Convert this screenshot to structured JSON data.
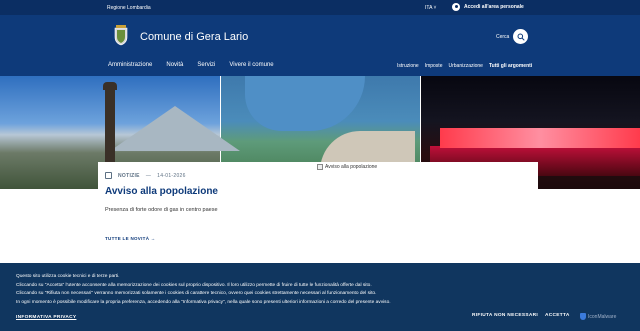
{
  "topbar": {
    "region": "Regione Lombardia",
    "language": "ITA",
    "login": "Accedi all'area personale"
  },
  "header": {
    "site_title": "Comune di Gera Lario",
    "search_label": "Cerca"
  },
  "mainnav": [
    "Amministrazione",
    "Novità",
    "Servizi",
    "Vivere il comune"
  ],
  "subnav": [
    "Istruzione",
    "Imposte",
    "Urbanizzazione",
    "Tutti gli argomenti"
  ],
  "news": {
    "category": "NOTIZIE",
    "separator": "—",
    "date": "14-01-2026",
    "title": "Avviso alla popolazione",
    "description": "Presenza di forte odore di gas in centro paese",
    "image_alt": "Avviso alla popolazione"
  },
  "all_news": "TUTTE LE NOVITÀ",
  "cookie": {
    "lines": [
      "Questo sito utilizza cookie tecnici e di terze parti.",
      "Cliccando su \"Accetta\" l'utente acconsente alla memorizzazione dei cookies sul proprio dispositivo. Il loro utilizzo permette di fruire di tutte le funzionalità offerte dal sito.",
      "Cliccando su \"Rifiuta non necessari\" verranno memorizzati solamente i cookies di carattere tecnico, ovvero quei cookies strettamente necessari al funzionamento del sito.",
      "In ogni momento è possibile modificare la propria preferenza, accedendo alla \"Informativa privacy\", nella quale sono presenti ulteriori informazioni a corredo del presente avviso."
    ],
    "policy_link": "INFORMATIVA PRIVACY",
    "reject": "RIFIUTA NON NECESSARI",
    "accept": "ACCETTA",
    "badge": "IconMalware"
  },
  "colors": {
    "topbar": "#0b2e63",
    "header": "#0e3a7a",
    "cookie_bg": "#10365f"
  }
}
